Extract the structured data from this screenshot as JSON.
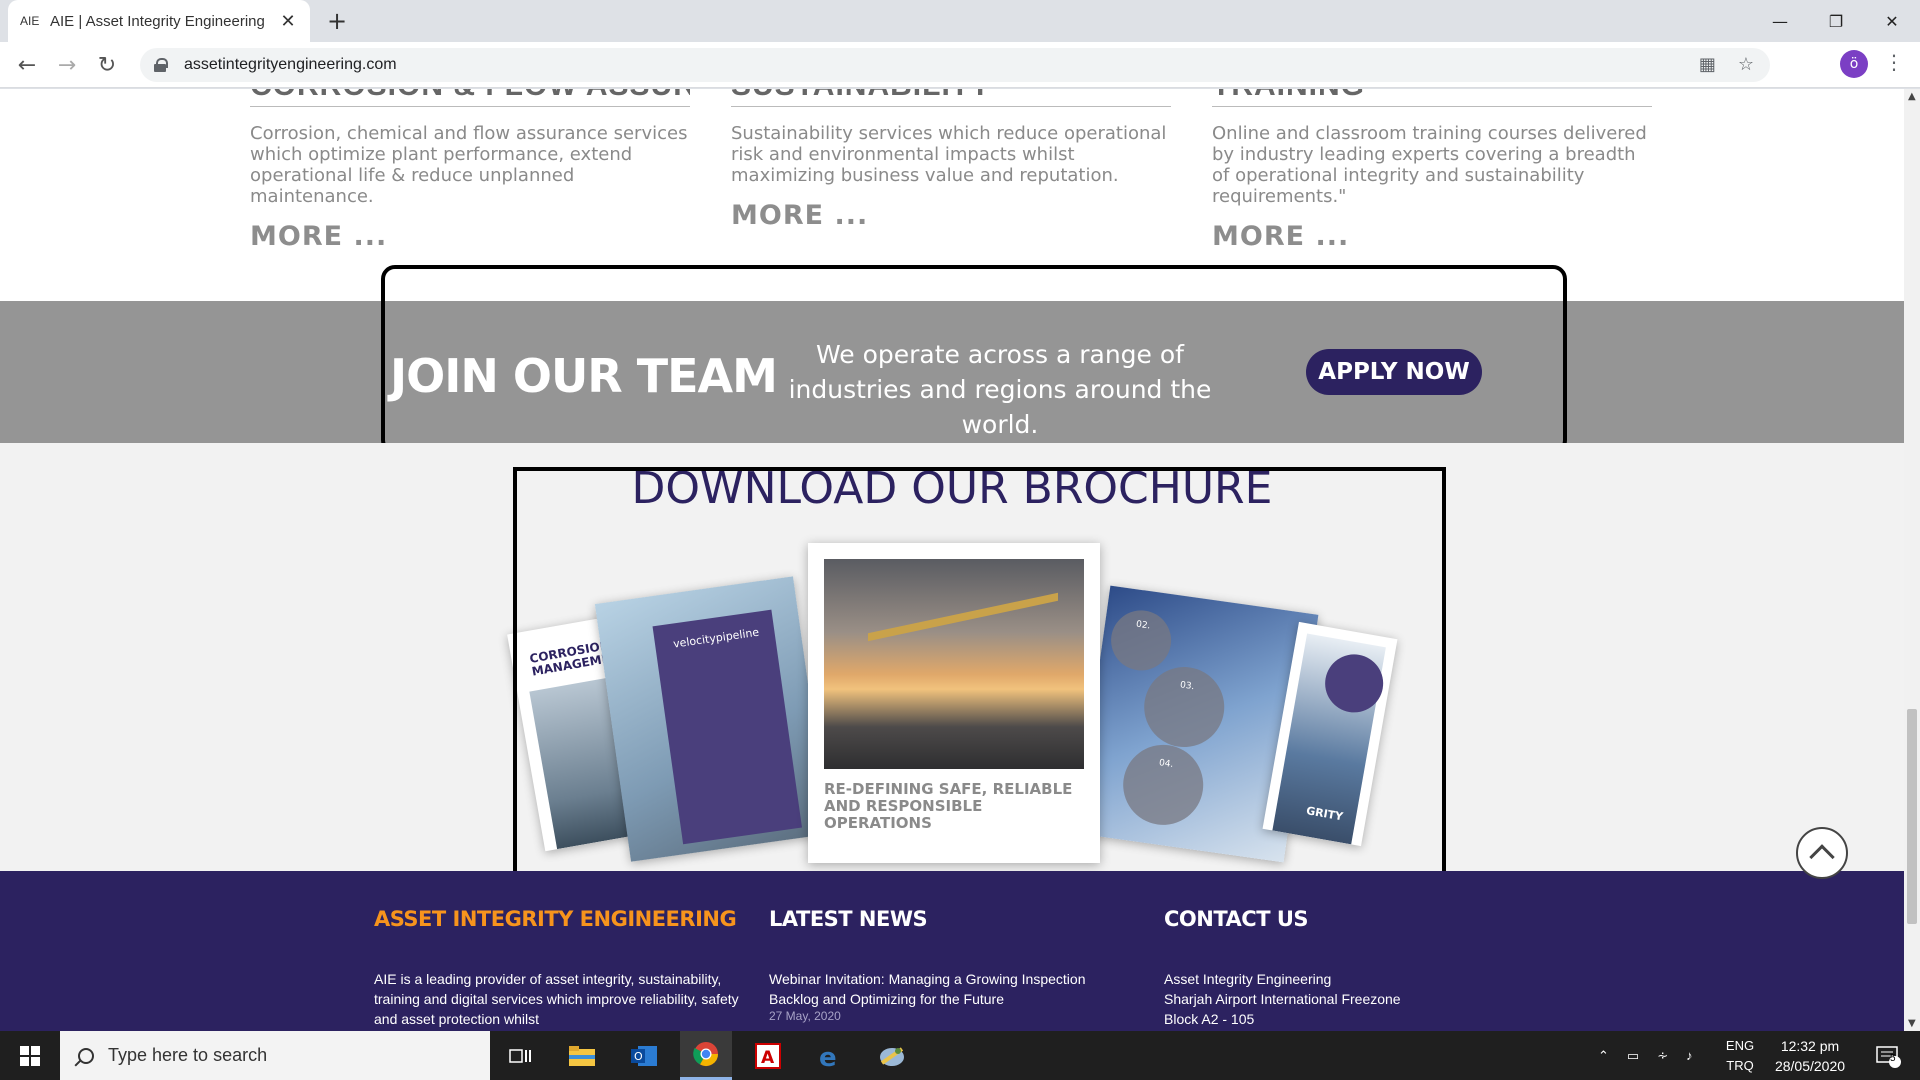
{
  "browser": {
    "tab_favicon": "AIE",
    "tab_title": "AIE | Asset Integrity Engineering",
    "url": "assetintegrityengineering.com",
    "profile_initial": "ö"
  },
  "services": [
    {
      "heading": "CORROSION & FLOW ASSURANCE",
      "description": "Corrosion, chemical and flow assurance services which optimize plant performance, extend operational life & reduce unplanned maintenance.",
      "more": "MORE ..."
    },
    {
      "heading": "SUSTAINABILITY",
      "description": "Sustainability services which reduce operational risk and environmental impacts whilst maximizing business value and reputation.",
      "more": "MORE ..."
    },
    {
      "heading": "TRAINING",
      "description": "Online and classroom training courses delivered by industry leading experts covering a breadth of operational integrity and sustainability requirements.\"",
      "more": "MORE ..."
    }
  ],
  "join": {
    "title": "JOIN OUR TEAM",
    "text": "We operate across a range of industries and regions around the world.",
    "button": "APPLY NOW"
  },
  "brochure": {
    "title": "DOWNLOAD OUR BROCHURE",
    "cover_caption": "RE-DEFINING SAFE, RELIABLE AND RESPONSIBLE OPERATIONS",
    "page1_label": "CORROSION & MANAGEMENT",
    "page2_label": "velocitypipeline",
    "page4_labels": [
      "02.",
      "03.",
      "04."
    ],
    "page5_label": "GRITY"
  },
  "footer": {
    "col1": {
      "heading": "ASSET INTEGRITY ENGINEERING",
      "body": "AIE is a leading provider of asset integrity, sustainability, training and digital services which improve reliability, safety and asset protection whilst"
    },
    "col2": {
      "heading": "LATEST NEWS",
      "news_title": "Webinar Invitation: Managing a Growing Inspection Backlog and Optimizing for the Future",
      "news_date": "27 May, 2020"
    },
    "col3": {
      "heading": "CONTACT US",
      "line1": "Asset Integrity Engineering",
      "line2": "Sharjah Airport International Freezone",
      "line3": "Block A2 - 105"
    }
  },
  "taskbar": {
    "search_placeholder": "Type here to search",
    "lang_top": "ENG",
    "lang_bottom": "TRQ",
    "time": "12:32 pm",
    "date": "28/05/2020",
    "notification_count": "5"
  },
  "colors": {
    "brand_navy": "#2c2260",
    "accent_orange": "#f7941d",
    "band_gray": "#959595"
  }
}
